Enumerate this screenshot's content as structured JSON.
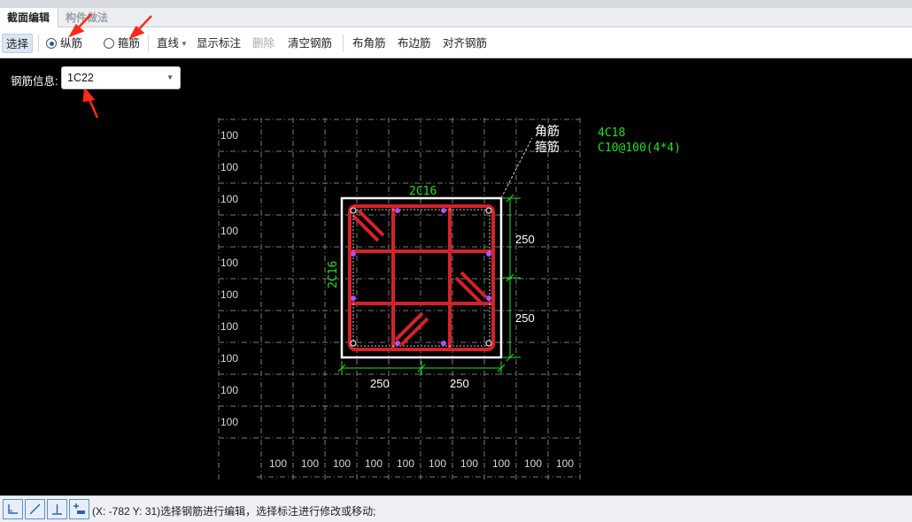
{
  "tabs": [
    {
      "label": "截面编辑"
    },
    {
      "label": "构件做法"
    }
  ],
  "toolbar": {
    "select": "选择",
    "longitudinal": "纵筋",
    "stirrup": "箍筋",
    "line_mode": "直线",
    "show_dims": "显示标注",
    "delete": "删除",
    "clear": "清空钢筋",
    "corner": "布角筋",
    "edge": "布边筋",
    "align": "对齐钢筋"
  },
  "rebar_info": {
    "label": "钢筋信息:",
    "value": "1C22"
  },
  "drawing": {
    "corner_label": "角筋",
    "stirrup_label": "箍筋",
    "corner_spec": "4C18",
    "stirrup_spec": "C10@100(4*4)",
    "top_spec": "2C16",
    "side_spec": "2C16",
    "right_dims": [
      "250",
      "250"
    ],
    "bottom_dims": [
      "250",
      "250"
    ],
    "grid_left_labels": [
      "100",
      "100",
      "100",
      "100",
      "100",
      "100",
      "100",
      "100",
      "100",
      "100"
    ],
    "grid_bottom_labels": [
      "100",
      "100",
      "100",
      "100",
      "100",
      "100",
      "100",
      "100",
      "100",
      "100"
    ],
    "colors": {
      "rebar": "#d4222a",
      "annotation": "#20e020",
      "outline": "#ffffff",
      "grid": "#7a7a7a",
      "bar_dot": "#b050ff"
    }
  },
  "status": {
    "text": "(X: -782 Y: 31)选择钢筋进行编辑，选择标注进行修改或移动;"
  },
  "status_icons": [
    "ortho-icon",
    "line-snap-icon",
    "perpendicular-icon",
    "dimension-icon"
  ]
}
